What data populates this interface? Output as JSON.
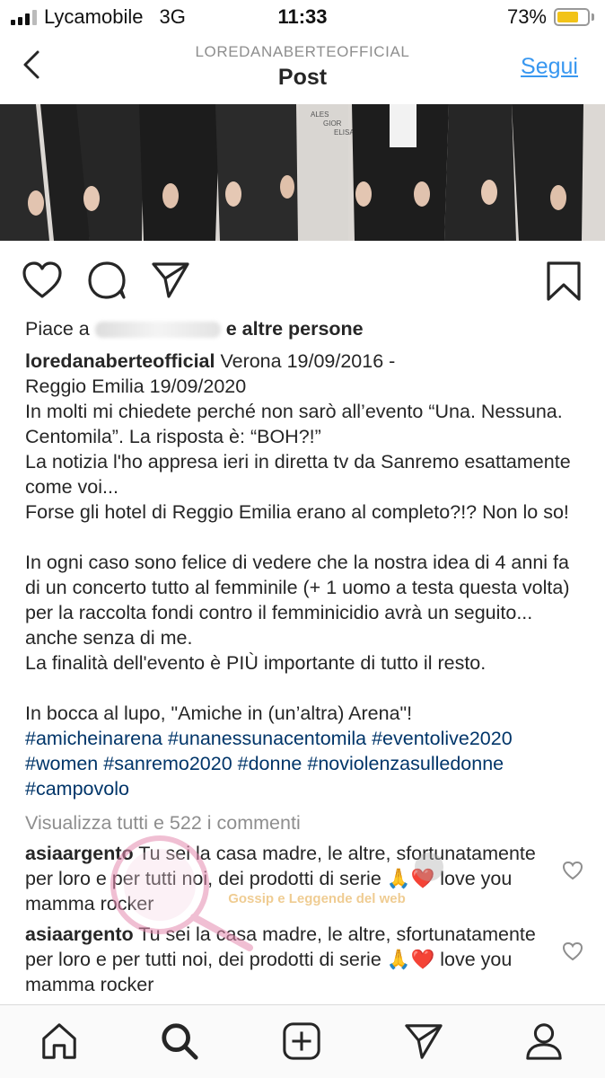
{
  "status_bar": {
    "carrier": "Lycamobile",
    "network": "3G",
    "time": "11:33",
    "battery": "73%",
    "battery_level": 0.73,
    "battery_color": "#f2c318"
  },
  "header": {
    "username": "LOREDANABERTEOFFICIAL",
    "title": "Post",
    "follow_label": "Segui",
    "back_icon": "chevron-left-icon",
    "accent": "#3897f0"
  },
  "actions": {
    "icons": [
      "heart-icon",
      "comment-icon",
      "share-icon",
      "bookmark-icon"
    ]
  },
  "post": {
    "likes_prefix": "Piace a",
    "likes_suffix": "e altre persone",
    "author": "loredanaberteofficial",
    "caption_lines": [
      " Verona 19/09/2016 -",
      "Reggio Emilia 19/09/2020",
      "In molti mi chiedete perché non sarò all’evento “Una. Nessuna. Centomila”. La risposta è: “BOH?!”",
      "La notizia l'ho appresa ieri in diretta tv da Sanremo esattamente come voi...",
      "Forse gli hotel di Reggio Emilia erano al completo?!? Non lo so!",
      "",
      "In ogni caso sono felice di vedere che la nostra idea di 4 anni fa di un concerto tutto al femminile (+ 1 uomo a testa questa volta) per la raccolta fondi contro il femminicidio avrà un seguito... anche senza di me.",
      "La  finalità dell'evento è PIÙ importante di tutto il resto.",
      "",
      "In bocca al lupo, \"Amiche in (un’altra) Arena\"!"
    ],
    "hashtags": "#amicheinarena #unanessunacentomila #eventolive2020 #women #sanremo2020 #donne #noviolenzasulledonne #campovolo",
    "view_all": "Visualizza tutti e 522 i commenti",
    "hashtag_color": "#003569"
  },
  "comments": [
    {
      "user": "asiaargento",
      "text": " Tu sei la casa madre, le altre, sfortunatamente per loro e per tutti noi, dei prodotti di serie 🙏❤️ love you mamma rocker"
    },
    {
      "user": "asiaargento",
      "text": " Tu sei la casa madre, le altre, sfortunatamente per loro e per tutti noi, dei prodotti di serie 🙏❤️ love you mamma rocker"
    }
  ],
  "watermark": {
    "text": "Gossip e Leggende del web"
  },
  "tab_bar": {
    "icons": [
      "home-icon",
      "search-icon",
      "new-post-icon",
      "direct-icon",
      "profile-icon"
    ]
  }
}
